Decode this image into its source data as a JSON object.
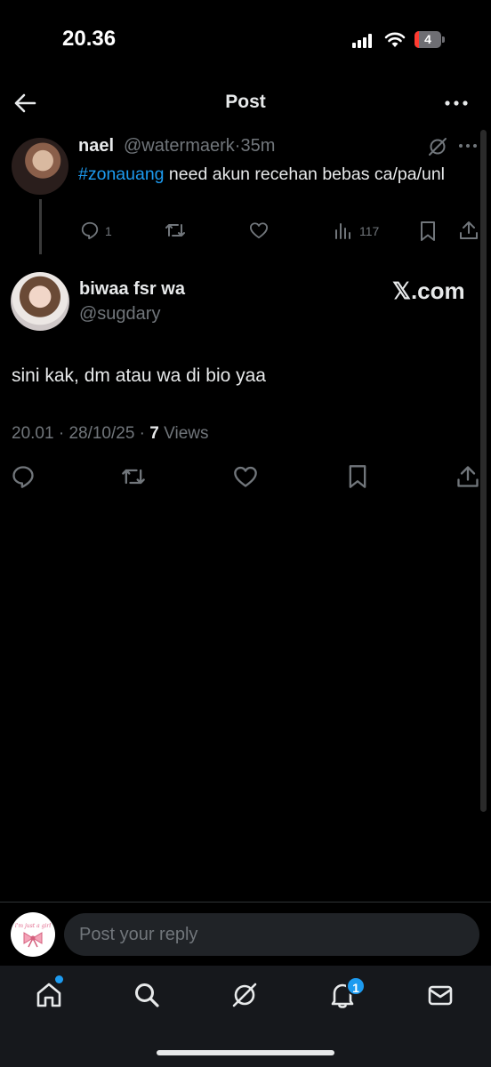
{
  "status_bar": {
    "time": "20.36",
    "battery": "4"
  },
  "header": {
    "title": "Post"
  },
  "parent_tweet": {
    "name": "nael",
    "handle": "@watermaerk",
    "separator": "·",
    "time": "35m",
    "hashtag": "#zonauang",
    "text": " need akun recehan bebas ca/pa/unl",
    "replies": "1",
    "views": "117"
  },
  "main_tweet": {
    "name": "biwaa fsr wa",
    "handle": "@sugdary",
    "source_badge": "𝕏.com",
    "text": "sini kak, dm atau wa di bio yaa",
    "time": "20.01",
    "date": "28/10/25",
    "views_count": "7",
    "views_label": "Views"
  },
  "reply_bar": {
    "placeholder": "Post your reply",
    "avatar_caption": "i'm just a girl"
  },
  "bottom_nav": {
    "notifications_badge": "1"
  },
  "colors": {
    "accent": "#1d9bf0",
    "background": "#000000",
    "muted": "#71767b"
  },
  "icons": [
    "back-arrow-icon",
    "more-icon",
    "grok-icon",
    "reply-icon",
    "retweet-icon",
    "like-icon",
    "views-icon",
    "bookmark-icon",
    "share-icon",
    "home-icon",
    "search-icon",
    "grok-nav-icon",
    "notifications-icon",
    "messages-icon"
  ]
}
